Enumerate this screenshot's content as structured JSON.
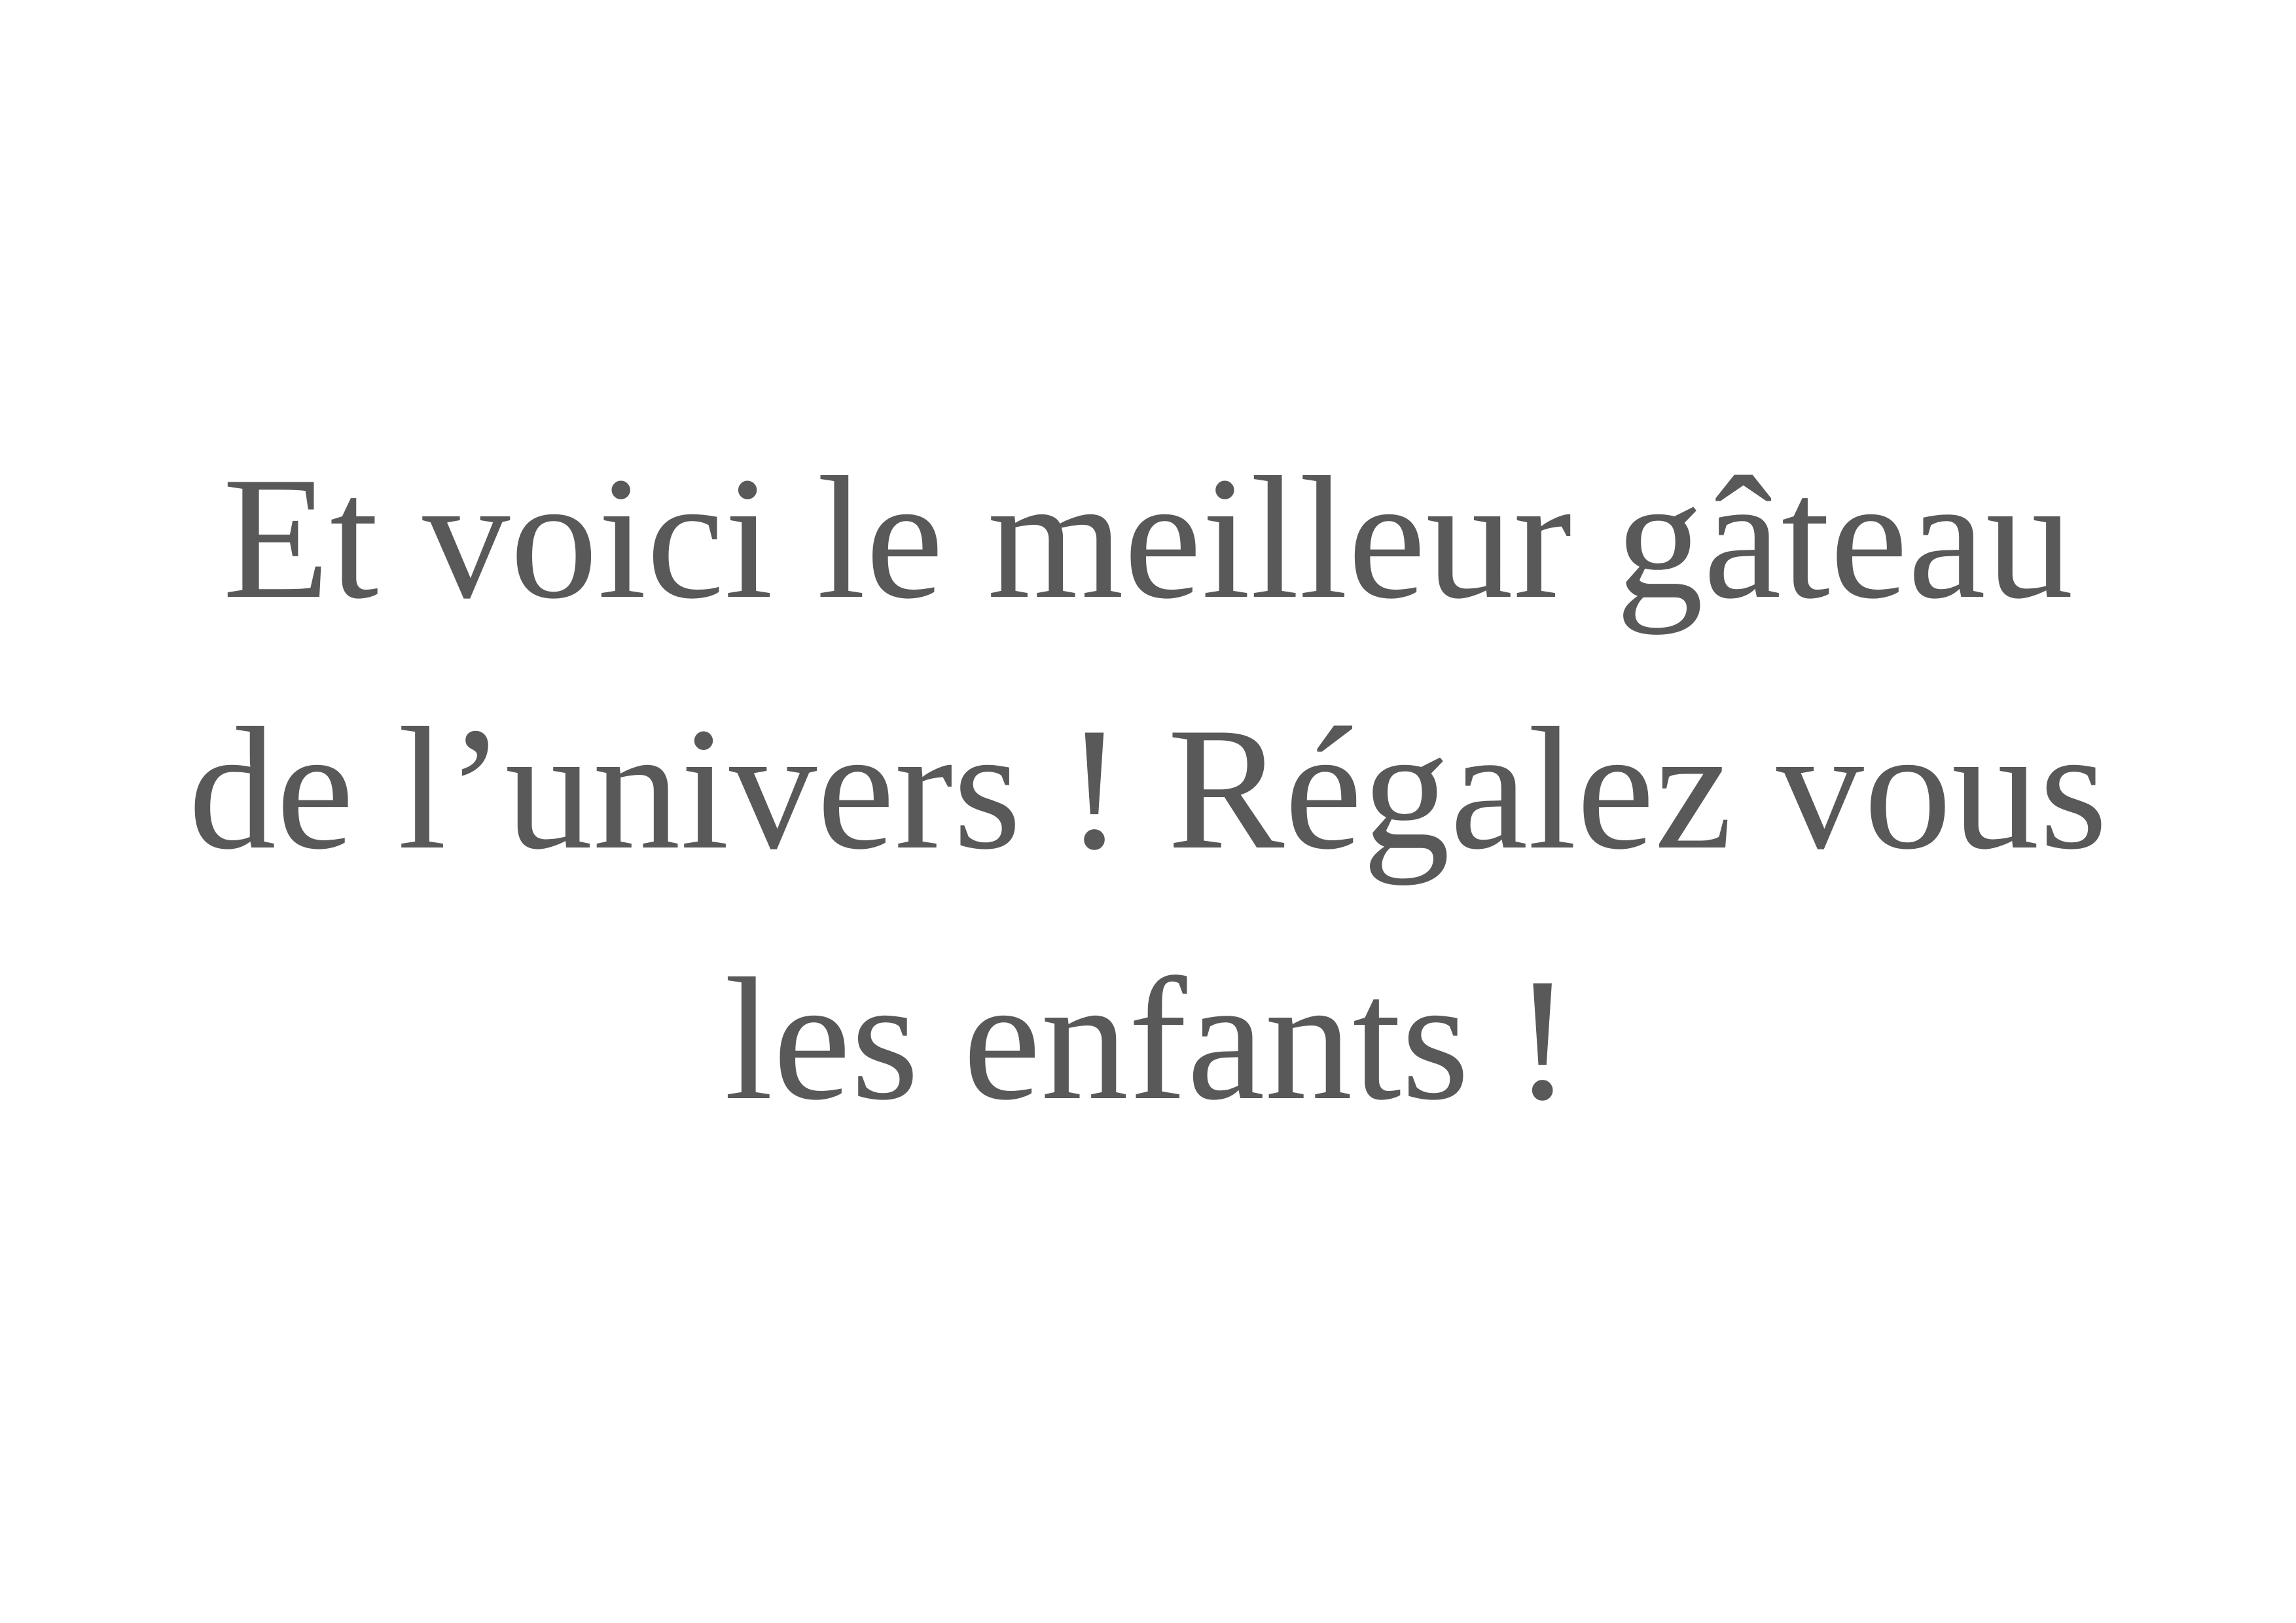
{
  "document": {
    "lines": [
      "Et voici le meilleur gâteau",
      "de l’univers ! Régalez vous",
      "les enfants !"
    ],
    "text_color": "#595959",
    "background_color": "#ffffff"
  }
}
